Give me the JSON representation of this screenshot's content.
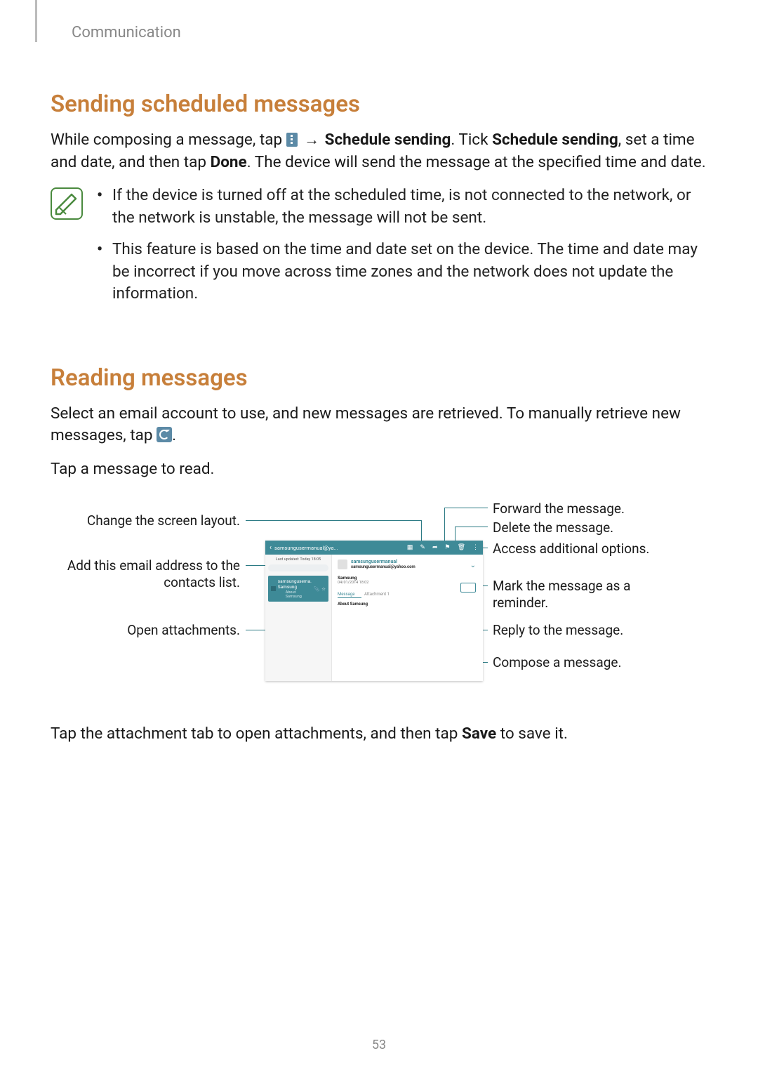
{
  "breadcrumb": "Communication",
  "page_number": "53",
  "section1": {
    "title": "Sending scheduled messages",
    "para_parts": {
      "t1": "While composing a message, tap ",
      "arrow": " → ",
      "b1": "Schedule sending",
      "t2": ". Tick ",
      "b2": "Schedule sending",
      "t3": ", set a time and date, and then tap ",
      "b3": "Done",
      "t4": ". The device will send the message at the specified time and date."
    },
    "notes": [
      "If the device is turned off at the scheduled time, is not connected to the network, or the network is unstable, the message will not be sent.",
      "This feature is based on the time and date set on the device. The time and date may be incorrect if you move across time zones and the network does not update the information."
    ]
  },
  "section2": {
    "title": "Reading messages",
    "para1_parts": {
      "t1": "Select an email account to use, and new messages are retrieved. To manually retrieve new messages, tap ",
      "t2": "."
    },
    "para2": "Tap a message to read.",
    "para3_parts": {
      "t1": "Tap the attachment tab to open attachments, and then tap ",
      "b1": "Save",
      "t2": " to save it."
    }
  },
  "callouts": {
    "left": {
      "layout": "Change the screen layout.",
      "add_contact": "Add this email address to the contacts list.",
      "attachments": "Open attachments."
    },
    "right": {
      "forward": "Forward the message.",
      "delete": "Delete the message.",
      "options": "Access additional options.",
      "flag": "Mark the message as a reminder.",
      "reply": "Reply to the message.",
      "compose": "Compose a message."
    }
  },
  "screenshot": {
    "back_label": "samsungusermanual@ya...",
    "updated": "Last updated: Today 18:05",
    "list_item": {
      "sender": "samsungusema.",
      "subject": "Samsung",
      "preview": "About Samsung"
    },
    "from_name": "samsungusermanual",
    "from_email": "samsungusermanual@yahoo.com",
    "subject": "Samsung",
    "date": "04/01/2014 18:02",
    "tab_message": "Message",
    "tab_attachment": "Attachment 1",
    "content": "About Samsung"
  }
}
